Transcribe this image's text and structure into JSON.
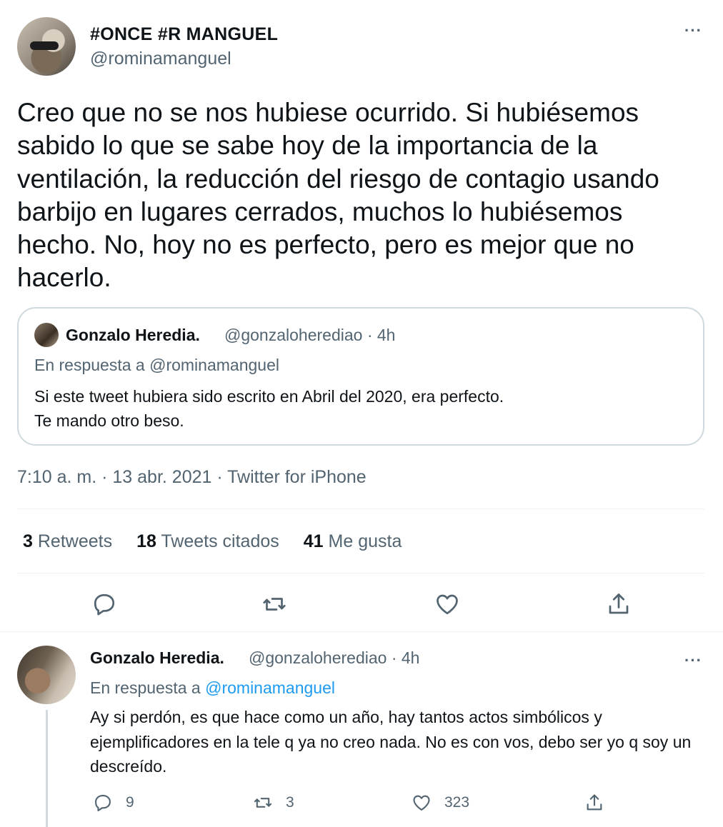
{
  "tweet": {
    "author_name": "#ONCE #R MANGUEL",
    "author_handle": "@rominamanguel",
    "more_label": "···",
    "text": "Creo que no se nos hubiese ocurrido. Si hubiésemos sabido lo que se sabe hoy de la importancia de la ventilación, la reducción del riesgo de contagio usando barbijo en lugares cerrados, muchos lo hubiésemos hecho. No, hoy no es perfecto, pero es mejor que no hacerlo.",
    "quote": {
      "author_name": "Gonzalo Heredia.",
      "author_handle": "@gonzaloherediao · 4h",
      "reply_to": "En respuesta a @rominamanguel",
      "text_line1": "Si este tweet hubiera sido escrito en Abril del 2020, era perfecto.",
      "text_line2": "Te mando otro beso."
    },
    "meta": "7:10 a. m. · 13 abr. 2021 · Twitter for iPhone",
    "stats": {
      "retweets_count": "3",
      "retweets_label": "Retweets",
      "quotes_count": "18",
      "quotes_label": "Tweets citados",
      "likes_count": "41",
      "likes_label": "Me gusta"
    }
  },
  "reply": {
    "author_name": "Gonzalo Heredia.",
    "author_handle": "@gonzaloherediao · 4h",
    "more_label": "···",
    "reply_prefix": "En respuesta a ",
    "reply_mention": "@rominamanguel",
    "text": "Ay si perdón, es que hace como un año, hay tantos actos simbólicos y ejemplificadores en la tele q ya no creo nada. No es con vos, debo ser yo q soy un descreído.",
    "counts": {
      "replies": "9",
      "retweets": "3",
      "likes": "323"
    }
  },
  "colors": {
    "text": "#0f1419",
    "secondary": "#536471",
    "link": "#1d9bf0",
    "border": "#cfd9de"
  }
}
